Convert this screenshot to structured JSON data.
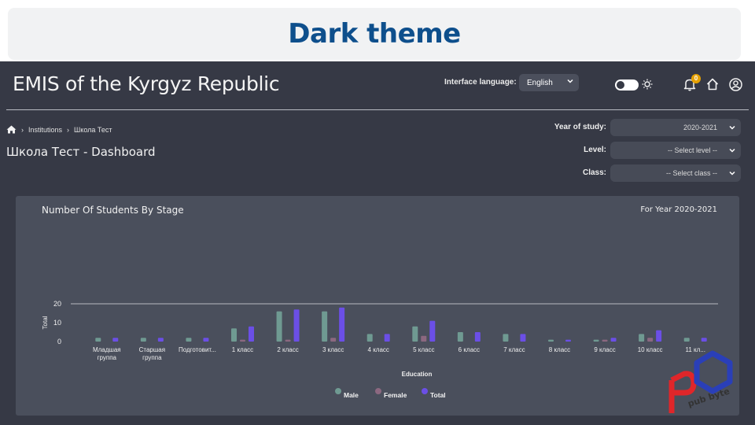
{
  "banner": {
    "title": "Dark theme"
  },
  "header": {
    "app_title": "EMIS of the Kyrgyz Republic",
    "language_label": "Interface language:",
    "language_value": "English",
    "notification_count": "0"
  },
  "breadcrumb": {
    "items": [
      "Institutions",
      "Школа Тест"
    ]
  },
  "page": {
    "title": "Школа Тест - Dashboard"
  },
  "filters": {
    "year_label": "Year of study:",
    "year_value": "2020-2021",
    "level_label": "Level:",
    "level_value": "-- Select level --",
    "class_label": "Class:",
    "class_value": "-- Select class --"
  },
  "card": {
    "title": "Number Of Students By Stage",
    "year": "For Year 2020-2021"
  },
  "colors": {
    "male": "#6f9a92",
    "female": "#8c6880",
    "total": "#6b4fe6",
    "axis": "#b8bac0"
  },
  "chart_data": {
    "type": "bar",
    "categories": [
      [
        "Младшая",
        "группа"
      ],
      [
        "Старшая",
        "группа"
      ],
      [
        "Подготовит..."
      ],
      [
        "1 класс"
      ],
      [
        "2 класс"
      ],
      [
        "3 класс"
      ],
      [
        "4 класс"
      ],
      [
        "5 класс"
      ],
      [
        "6 класс"
      ],
      [
        "7 класс"
      ],
      [
        "8 класс"
      ],
      [
        "9 класс"
      ],
      [
        "10 класс"
      ],
      [
        "11 кл..."
      ]
    ],
    "series": [
      {
        "name": "Male",
        "values": [
          2,
          2,
          2,
          7,
          16,
          16,
          4,
          8,
          5,
          4,
          1,
          1,
          4,
          2
        ]
      },
      {
        "name": "Female",
        "values": [
          0,
          0,
          0,
          1,
          1,
          2,
          0,
          3,
          0,
          0,
          0,
          1,
          2,
          0
        ]
      },
      {
        "name": "Total",
        "values": [
          2,
          2,
          2,
          8,
          17,
          18,
          4,
          11,
          5,
          4,
          1,
          2,
          6,
          2
        ]
      }
    ],
    "xlabel": "Education",
    "ylabel": "Total",
    "ylim": [
      0,
      20
    ],
    "yticks": [
      "0",
      "10",
      "20"
    ],
    "grid": "top line only",
    "legend": "bottom-center"
  }
}
